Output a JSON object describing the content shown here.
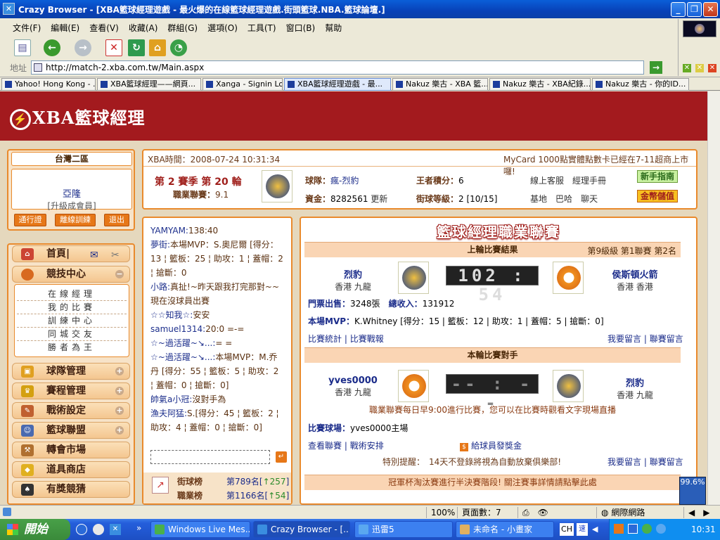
{
  "window": {
    "title": "Crazy Browser - [XBA籃球經理遊戲 - 最火爆的在線籃球經理遊戲.街頭籃球.NBA.籃球論壇.]"
  },
  "menu": [
    "文件(F)",
    "編輯(E)",
    "查看(V)",
    "收藏(A)",
    "群組(G)",
    "選項(O)",
    "工具(T)",
    "窗口(B)",
    "幫助"
  ],
  "address": {
    "label": "地址",
    "url": "http://match-2.xba.com.tw/Main.aspx"
  },
  "tabs": [
    "Yahoo! Hong Kong - ...",
    "XBA籃球經理——網頁...",
    "Xanga - Signin Lock",
    "XBA籃球經理遊戲 - 最...",
    "Nakuz 樂古 - XBA 籃...",
    "Nakuz 樂古 - XBA紀錄...",
    "Nakuz 樂古 - 你的ID..."
  ],
  "site": {
    "logo": "XBA籃球經理"
  },
  "left": {
    "region": "台灣二區",
    "username": "亞隆",
    "member": "[升級成會員]",
    "buttons": [
      "通行證",
      "離線訓練",
      "退出"
    ]
  },
  "nav": {
    "home": "首頁|",
    "competition": "競技中心",
    "sub": [
      "在線經理",
      "我的比賽",
      "訓練中心",
      "同城交友",
      "勝者為王"
    ],
    "items": [
      "球隊管理",
      "賽程管理",
      "戰術設定",
      "籃球聯盟",
      "轉會市場",
      "道具商店",
      "有獎競猜"
    ]
  },
  "info": {
    "time_label": "XBA時間：",
    "time": "2008-07-24 10:31:34",
    "notice": "MyCard 1000點實體點數卡已經在7-11超商上市囉!",
    "season": "第 2 賽季 第 20 輪",
    "rating_label": "職業聯賽：",
    "rating": "9.1",
    "team_label": "球隊：",
    "team": "瘋-烈豹",
    "score_label": "王者積分：",
    "score": "6",
    "cs": "線上客服",
    "manual": "經理手冊",
    "newbie": "新手指南",
    "funds_label": "資金：",
    "funds": "8282561",
    "update": "更新",
    "level_label": "街球等級：",
    "level": "2 [10/15]",
    "base": "基地",
    "barbar": "巴哈",
    "chat": "聊天",
    "gold": "金幣儲值"
  },
  "chat": [
    {
      "n": "YAMYAM:",
      "t": "138:40"
    },
    {
      "n": "夢街:",
      "t": "本場MVP：S.奧尼爾 [得分：13 ¦ 籃板：25 ¦ 助攻：1 ¦ 蓋帽：2 ¦ 搶斷：0"
    },
    {
      "n": "小路:",
      "t": "真扯!~昨天跟我打完那對~~現在沒球員出賽"
    },
    {
      "n": "☆☆知我☆:",
      "t": "安安"
    },
    {
      "n": "samuel1314:",
      "t": "20:0 =-="
    },
    {
      "n": "☆~過活躍~↘...:",
      "t": "= ="
    },
    {
      "n": "☆~過活躍~↘...:",
      "t": "本場MVP：M.乔丹 [得分：55 ¦ 籃板：5 ¦ 助攻：2 ¦ 蓋帽：0 ¦ 搶斷：0]"
    },
    {
      "n": "帥氣a小冠:",
      "t": "沒對手為"
    },
    {
      "n": "漁夫阿猛:",
      "t": "S.[得分：45 ¦ 籃板：2 ¦ 助攻：4 ¦ 蓋帽：0 ¦ 搶斷：0]"
    }
  ],
  "rank": [
    {
      "label": "街球榜",
      "value": "第789名",
      "delta": "↑257"
    },
    {
      "label": "職業榜",
      "value": "第1166名",
      "delta": "↑54"
    }
  ],
  "league": {
    "title": "籃球經理職業聯賽",
    "last_header": "上輪比賽結果",
    "last_info": "第9級級 第1聯賽 第2名",
    "home": {
      "name": "烈豹",
      "loc": "香港 九龍"
    },
    "score": "102 : 54",
    "away": {
      "name": "侯斯頓火箭",
      "loc": "香港 香港"
    },
    "ticket_label": "門票出售：",
    "ticket": "3248張",
    "income_label": "總收入：",
    "income": "131912",
    "mvp_label": "本場MVP：",
    "mvp": "K.Whitney [得分：15 | 籃板：12 | 助攻：1 | 蓋帽：5 | 搶斷：0]",
    "stats": "比賽統計",
    "report": "比賽戰報",
    "comment": "我要留言",
    "comment2": "聯賽留言",
    "next_header": "本輪比賽對手",
    "next_home": {
      "name": "yves0000",
      "loc": "香港 九龍"
    },
    "next_score": "-- : --",
    "next_away": {
      "name": "烈豹",
      "loc": "香港 九龍"
    },
    "daily": "職業聯賽每日早9:00進行比賽，您可以在比賽時觀看文字現場直播",
    "venue_label": "比賽球場：",
    "venue": "yves0000主場",
    "view": "查看聯賽",
    "tactic": "戰術安排",
    "bonus": "給球員發獎金",
    "remind": "特別提醒：　14天不登錄將視為自動放棄俱樂部!",
    "cup": "冠軍杯淘汰賽進行半決賽階段! 關注賽事詳情請點擊此處"
  },
  "status": {
    "zoom": "100%",
    "page": "頁面數：7",
    "zone": "網際網路",
    "pct": "99.6%"
  },
  "taskbar": {
    "start": "開始",
    "tasks": [
      "Windows Live Mes...",
      "Crazy Browser - [...",
      "迅雷5",
      "未命名 - 小畫家"
    ],
    "lang": "CH",
    "time": "10:31"
  }
}
